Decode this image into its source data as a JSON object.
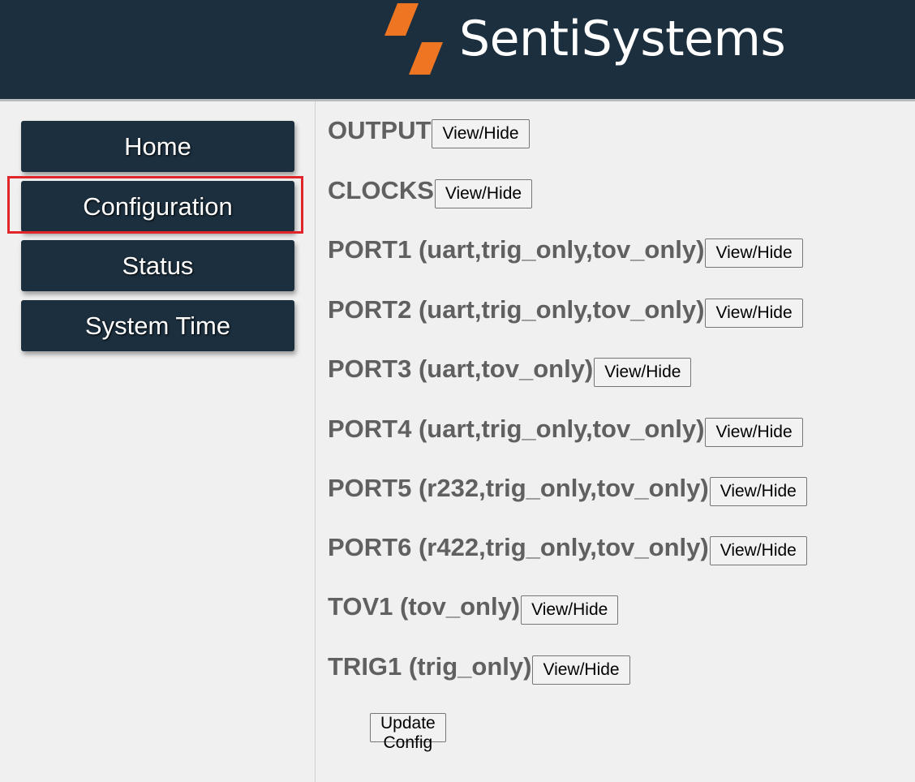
{
  "header": {
    "brand_name": "SentiSystems",
    "logo_icon": "sentisystems-logo-icon",
    "background_color": "#1c2f3e",
    "logo_color": "#ee7623"
  },
  "sidebar": {
    "items": [
      {
        "label": "Home"
      },
      {
        "label": "Configuration",
        "highlighted": true
      },
      {
        "label": "Status"
      },
      {
        "label": "System Time"
      }
    ],
    "highlight_color": "#e0262b"
  },
  "main": {
    "sections": [
      {
        "label": "OUTPUT",
        "button_label": "View/Hide"
      },
      {
        "label": "CLOCKS",
        "button_label": "View/Hide"
      },
      {
        "label": "PORT1 (uart,trig_only,tov_only)",
        "button_label": "View/Hide"
      },
      {
        "label": "PORT2 (uart,trig_only,tov_only)",
        "button_label": "View/Hide"
      },
      {
        "label": "PORT3 (uart,tov_only)",
        "button_label": "View/Hide"
      },
      {
        "label": "PORT4 (uart,trig_only,tov_only)",
        "button_label": "View/Hide"
      },
      {
        "label": "PORT5 (r232,trig_only,tov_only)",
        "button_label": "View/Hide"
      },
      {
        "label": "PORT6 (r422,trig_only,tov_only)",
        "button_label": "View/Hide"
      },
      {
        "label": "TOV1 (tov_only)",
        "button_label": "View/Hide"
      },
      {
        "label": "TRIG1 (trig_only)",
        "button_label": "View/Hide"
      }
    ],
    "update_button_label": "Update Config"
  }
}
